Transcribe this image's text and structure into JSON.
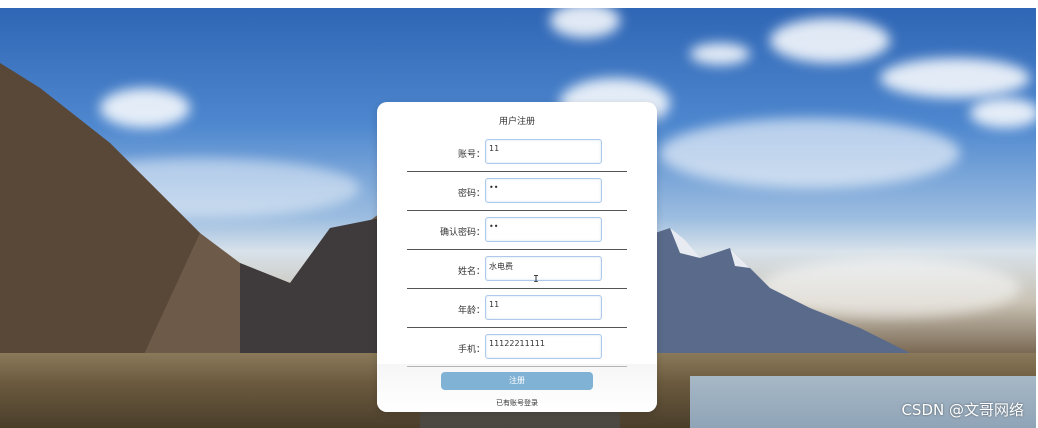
{
  "form": {
    "title": "用户注册",
    "fields": [
      {
        "label": "账号：",
        "value": "11"
      },
      {
        "label": "密码：",
        "value": "••"
      },
      {
        "label": "确认密码：",
        "value": "••"
      },
      {
        "label": "姓名：",
        "value": "水电费"
      },
      {
        "label": "年龄：",
        "value": "11"
      },
      {
        "label": "手机：",
        "value": "11122211111"
      }
    ],
    "submit_label": "注册",
    "login_link": "已有账号登录"
  },
  "watermark": "CSDN @文哥网络",
  "icons": {
    "text_cursor": "I-beam"
  }
}
